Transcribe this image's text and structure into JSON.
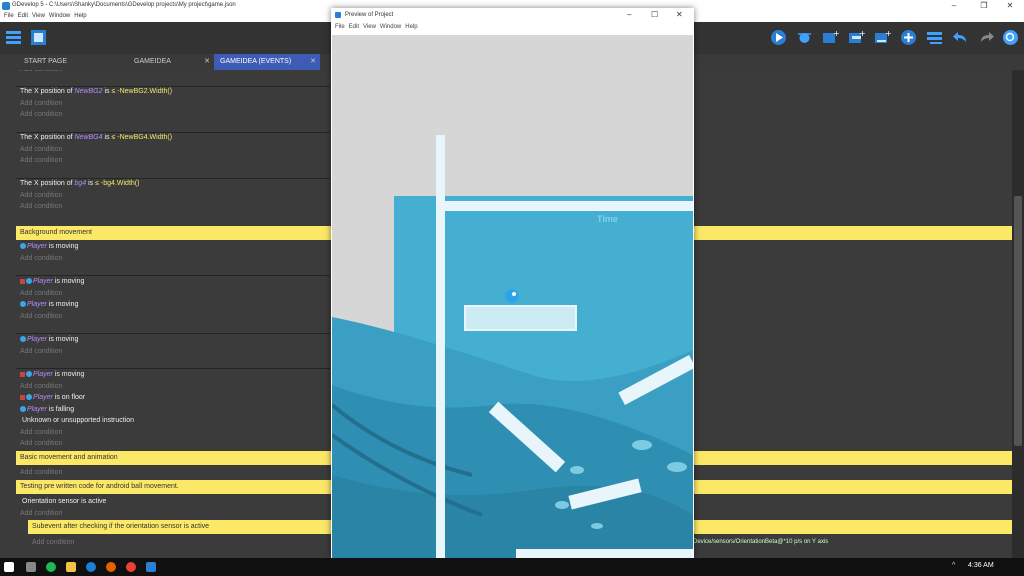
{
  "window": {
    "title": "GDevelop 5 - C:\\Users\\Shanky\\Documents\\GDevelop projects\\My project\\game.json",
    "controls": [
      "–",
      "❐",
      "✕"
    ]
  },
  "menu": [
    "File",
    "Edit",
    "View",
    "Window",
    "Help"
  ],
  "toolbar": {
    "left_icons": [
      "project-manager-icon",
      "scene-icon"
    ],
    "right_icons": [
      "preview-play-icon",
      "debug-icon",
      "add-event-icon",
      "add-subevent-icon",
      "add-other-icon",
      "add-comment-icon",
      "add-group-icon",
      "undo-icon",
      "redo-icon",
      "search-icon"
    ]
  },
  "tabs": [
    {
      "label": "START PAGE",
      "close": ""
    },
    {
      "label": "GAMEIDEA",
      "close": "✕"
    },
    {
      "label": "GAMEIDEA (EVENTS)",
      "close": "✕"
    }
  ],
  "events": {
    "add_condition": "Add condition",
    "cond1": {
      "pre": "The X position of",
      "obj": "NewBG2",
      "is": "is",
      "expr": "≤ -NewBG2.Width()"
    },
    "cond2": {
      "pre": "The X position of",
      "obj": "NewBG4",
      "is": "is",
      "expr": "≤ -NewBG4.Width()"
    },
    "cond3": {
      "pre": "The X position of",
      "obj": "bg4",
      "is": "is",
      "expr": "≤ -bg4.Width()"
    },
    "comment_bg": "Background movement",
    "player": "Player",
    "is_moving": "is moving",
    "is_on_floor": "is on floor",
    "is_falling": "is falling",
    "unknown": "Unknown or unsupported instruction",
    "comment_basic": "Basic movement and animation",
    "comment_testing": "Testing pre written code for android ball movement.",
    "orientation": "Orientation sensor is active",
    "comment_subevent": "Subevent after checking if the orientation sensor is active",
    "action_bottom": "Device/sensors/OrientationBeta@*10 p/s on Y axis"
  },
  "preview": {
    "title": "Preview of Project",
    "menu": [
      "File",
      "Edit",
      "View",
      "Window",
      "Help"
    ],
    "controls": [
      "–",
      "☐",
      "✕"
    ],
    "hud_label": "Time"
  },
  "taskbar": {
    "time": "4:36 AM",
    "caret": "^"
  },
  "colors": {
    "comment": "#fbe866",
    "active_tab": "#3e5bb5",
    "sea": "#3aa5c4",
    "ice": "#e8f6fb"
  }
}
